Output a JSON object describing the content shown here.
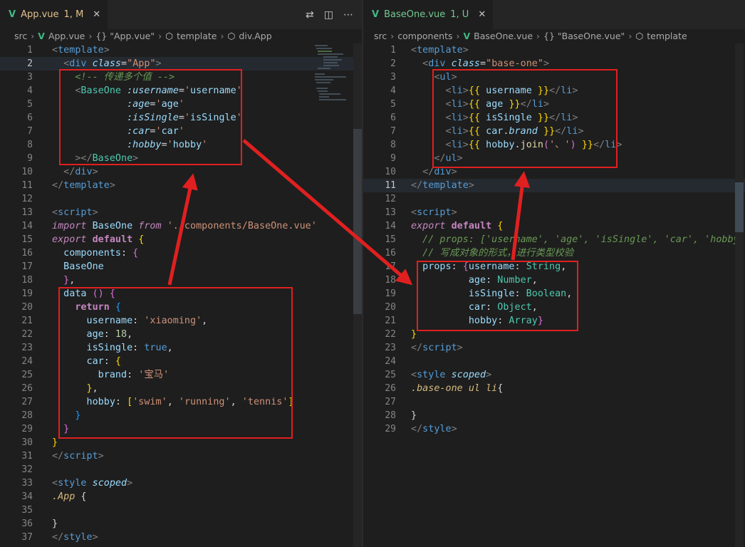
{
  "left": {
    "tab": {
      "label": "App.vue",
      "status": "1, M"
    },
    "breadcrumb": [
      "src",
      "App.vue",
      "{} \"App.vue\"",
      "template",
      "div.App"
    ],
    "active_line": 2,
    "lines": [
      {
        "n": "1"
      },
      {
        "n": "2"
      },
      {
        "n": "3"
      },
      {
        "n": "4"
      },
      {
        "n": "5"
      },
      {
        "n": "6"
      },
      {
        "n": "7"
      },
      {
        "n": "8"
      },
      {
        "n": "9"
      },
      {
        "n": "10"
      },
      {
        "n": "11"
      },
      {
        "n": "12"
      },
      {
        "n": "13"
      },
      {
        "n": "14"
      },
      {
        "n": "15"
      },
      {
        "n": "16"
      },
      {
        "n": "17"
      },
      {
        "n": "18"
      },
      {
        "n": "19"
      },
      {
        "n": "20"
      },
      {
        "n": "21"
      },
      {
        "n": "22"
      },
      {
        "n": "23"
      },
      {
        "n": "24"
      },
      {
        "n": "25"
      },
      {
        "n": "26"
      },
      {
        "n": "27"
      },
      {
        "n": "28"
      },
      {
        "n": "29"
      },
      {
        "n": "30"
      },
      {
        "n": "31"
      },
      {
        "n": "32"
      },
      {
        "n": "33"
      },
      {
        "n": "34"
      },
      {
        "n": "35"
      },
      {
        "n": "36"
      },
      {
        "n": "37"
      }
    ]
  },
  "right": {
    "tab": {
      "label": "BaseOne.vue",
      "status": "1, U"
    },
    "breadcrumb": [
      "src",
      "components",
      "BaseOne.vue",
      "{} \"BaseOne.vue\"",
      "template"
    ],
    "active_line": 11,
    "lines": [
      {
        "n": "1"
      },
      {
        "n": "2"
      },
      {
        "n": "3"
      },
      {
        "n": "4"
      },
      {
        "n": "5"
      },
      {
        "n": "6"
      },
      {
        "n": "7"
      },
      {
        "n": "8"
      },
      {
        "n": "9"
      },
      {
        "n": "10"
      },
      {
        "n": "11"
      },
      {
        "n": "12"
      },
      {
        "n": "13"
      },
      {
        "n": "14"
      },
      {
        "n": "15"
      },
      {
        "n": "16"
      },
      {
        "n": "17"
      },
      {
        "n": "18"
      },
      {
        "n": "19"
      },
      {
        "n": "20"
      },
      {
        "n": "21"
      },
      {
        "n": "22"
      },
      {
        "n": "23"
      },
      {
        "n": "24"
      },
      {
        "n": "25"
      },
      {
        "n": "26"
      },
      {
        "n": "27"
      },
      {
        "n": "28"
      },
      {
        "n": "29"
      }
    ]
  },
  "icons": {
    "vue": "vue-logo-icon",
    "compare": "compare-changes-icon",
    "split": "split-editor-icon",
    "more": "more-actions-icon",
    "close": "close-icon",
    "chevron": "chevron-right-icon"
  },
  "colors": {
    "annotation": "#e02020",
    "background": "#1e1e1e"
  }
}
